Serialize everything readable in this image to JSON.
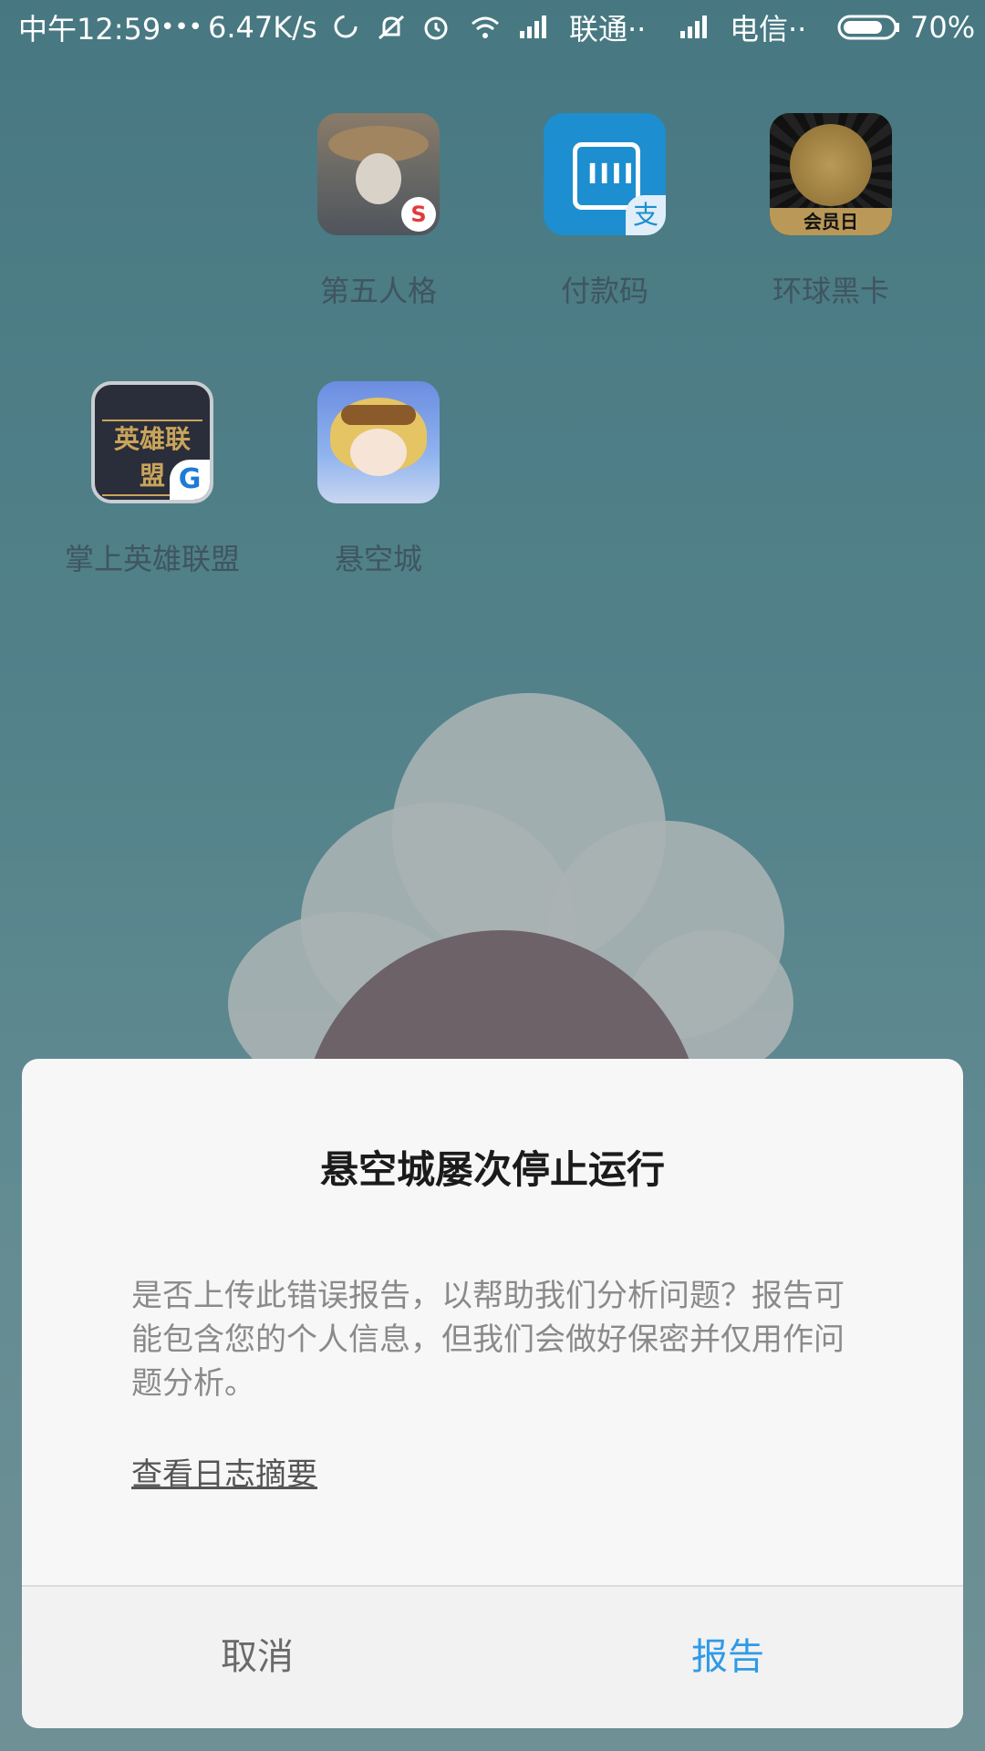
{
  "status_bar": {
    "time": "中午12:59",
    "dots": "•••",
    "speed": "6.47K/s",
    "carrier1": "联通··",
    "carrier2": "电信··",
    "battery": "70%"
  },
  "apps": [
    {
      "label": "第五人格",
      "icon": "identity-v-icon"
    },
    {
      "label": "付款码",
      "icon": "alipay-paycode-icon"
    },
    {
      "label": "环球黑卡",
      "icon": "black-card-icon",
      "icon_text": "会员日"
    },
    {
      "label": "掌上英雄联盟",
      "icon": "lol-icon",
      "icon_text": "英雄联盟"
    },
    {
      "label": "悬空城",
      "icon": "sky-city-icon"
    }
  ],
  "dialog": {
    "title": "悬空城屡次停止运行",
    "message": "是否上传此错误报告，以帮助我们分析问题？报告可能包含您的个人信息，但我们会做好保密并仅用作问题分析。",
    "link": "查看日志摘要",
    "cancel": "取消",
    "report": "报告"
  },
  "colors": {
    "accent": "#2f9ae6",
    "dialog_bg": "#f7f7f7"
  }
}
